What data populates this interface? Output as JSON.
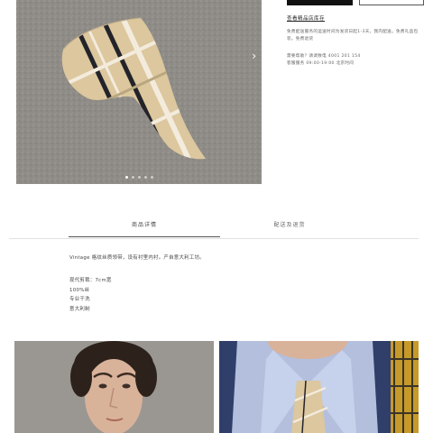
{
  "product": {
    "store_link": "查看精品店库存",
    "shipping_note_1": "免费配送服务的运送时间为发货日起1-3天。我内配送。免费礼品包",
    "shipping_note_2": "装。免费退货",
    "help_label": "需要帮助？请调致电 4001 201 154",
    "service_hours": "客服服务 09:00-19:00 北京时间"
  },
  "gallery": {
    "next_icon": "chevron-right-icon",
    "slide_count": 5,
    "active_slide": 0
  },
  "tabs": [
    {
      "label": "商品详情",
      "active": true
    },
    {
      "label": "配送及退货",
      "active": false
    }
  ],
  "details": {
    "intro": "Vintage 格纹丝质领带，设有衬里内衬。产自意大利工坊。",
    "specs": [
      "现代剪裁：7cm宽",
      "100%丝",
      "专业干洗",
      "意大利制"
    ]
  },
  "colors": {
    "tie_base": "#dcc79e",
    "tie_stripe_dark": "#23232a",
    "tie_stripe_light": "#f3ebdc",
    "background_gray": "#8f8c87"
  }
}
